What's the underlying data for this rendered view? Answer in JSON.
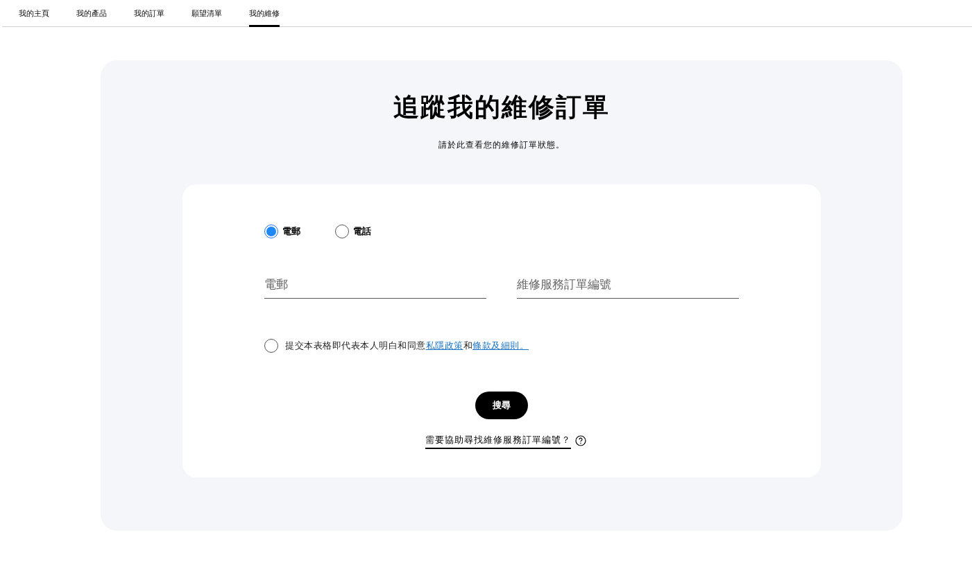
{
  "tabs": [
    {
      "label": "我的主頁",
      "selected": false
    },
    {
      "label": "我的產品",
      "selected": false
    },
    {
      "label": "我的訂單",
      "selected": false
    },
    {
      "label": "願望清單",
      "selected": false
    },
    {
      "label": "我的維修",
      "selected": true
    }
  ],
  "heading": "追蹤我的維修訂單",
  "subheading": "請於此查看您的維修訂單狀態。",
  "contact_options": [
    {
      "label": "電郵",
      "selected": true
    },
    {
      "label": "電話",
      "selected": false
    }
  ],
  "fields": [
    {
      "placeholder": "電郵"
    },
    {
      "placeholder": "維修服務訂單編號"
    }
  ],
  "consent": {
    "checked": false,
    "parts": [
      {
        "kind": "text",
        "text": "提交本表格即代表本人明白和同意"
      },
      {
        "kind": "link",
        "text": "私隱政策"
      },
      {
        "kind": "text",
        "text": "和"
      },
      {
        "kind": "link",
        "text": "條款及細則。"
      }
    ]
  },
  "search_button": "搜尋",
  "help_link": "需要協助尋找維修服務訂單編號？"
}
